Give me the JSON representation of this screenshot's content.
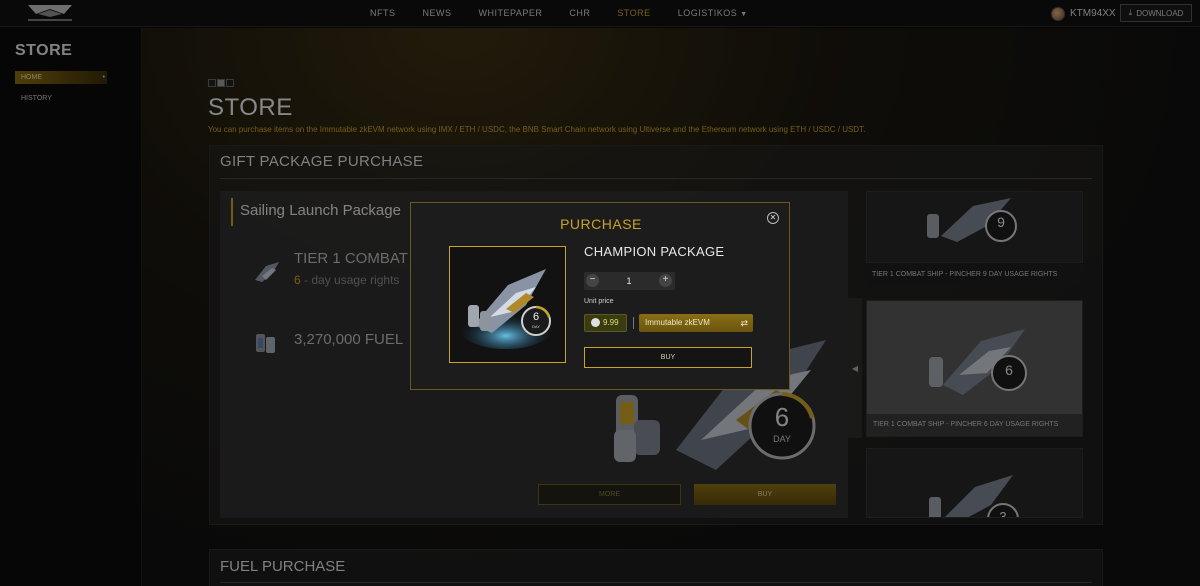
{
  "header": {
    "nav": [
      "NFTS",
      "NEWS",
      "WHITEPAPER",
      "CHR",
      "STORE",
      "LOGISTIKOS"
    ],
    "active_nav": "STORE",
    "username": "KTM94XX",
    "download_label": "DOWNLOAD"
  },
  "sidebar": {
    "title": "STORE",
    "items": [
      {
        "label": "HOME"
      },
      {
        "label": "HISTORY"
      }
    ]
  },
  "main": {
    "title": "STORE",
    "description": "You can purchase items on the Immutable zkEVM network using IMX / ETH / USDC, the BNB Smart Chain network using Ultiverse and the Ethereum network using ETH / USDC / USDT.",
    "gift_section": {
      "title": "GIFT PACKAGE PURCHASE",
      "package_name": "Sailing Launch Package",
      "tier_title": "TIER 1 COMBAT S",
      "tier_days": "6",
      "tier_suffix": "- day usage rights",
      "fuel_title": "3,270,000 FUEL",
      "big_day_number": "6",
      "big_day_label": "DAY",
      "more_label": "MORE",
      "buy_label": "BUY"
    },
    "carousel": [
      {
        "caption": "TIER 1 COMBAT SHIP - PINCHER 9 DAY USAGE RIGHTS",
        "day": "9"
      },
      {
        "caption": "TIER 1 COMBAT SHIP - PINCHER 6 DAY USAGE RIGHTS",
        "day": "6"
      },
      {
        "caption": "",
        "day": "3"
      }
    ],
    "fuel_section": {
      "title": "FUEL PURCHASE"
    }
  },
  "modal": {
    "title": "PURCHASE",
    "package": "CHAMPION PACKAGE",
    "quantity": "1",
    "unit_price_label": "Unit price",
    "price": "9.99",
    "network": "Immutable zkEVM",
    "buy_label": "BUY",
    "day_number": "6",
    "day_label": "DAY"
  },
  "colors": {
    "accent": "#c9a227",
    "background": "#0a0a0a"
  }
}
